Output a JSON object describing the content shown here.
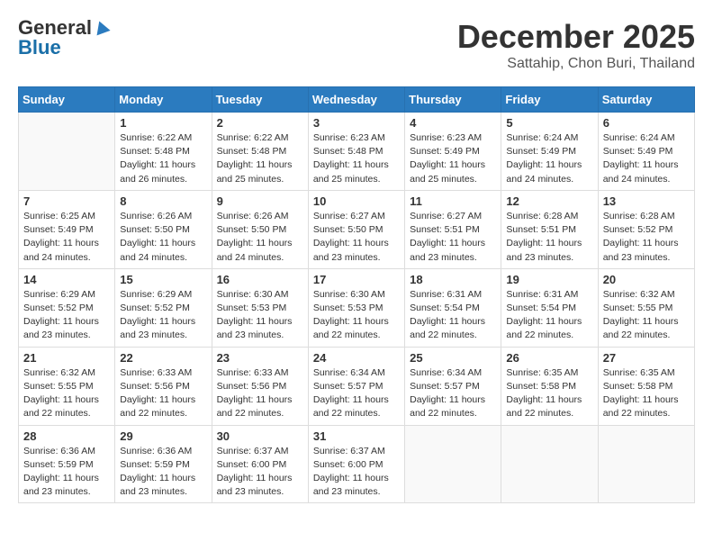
{
  "header": {
    "logo_general": "General",
    "logo_blue": "Blue",
    "month_title": "December 2025",
    "location": "Sattahip, Chon Buri, Thailand"
  },
  "days_of_week": [
    "Sunday",
    "Monday",
    "Tuesday",
    "Wednesday",
    "Thursday",
    "Friday",
    "Saturday"
  ],
  "weeks": [
    [
      {
        "day": "",
        "info": ""
      },
      {
        "day": "1",
        "info": "Sunrise: 6:22 AM\nSunset: 5:48 PM\nDaylight: 11 hours and 26 minutes."
      },
      {
        "day": "2",
        "info": "Sunrise: 6:22 AM\nSunset: 5:48 PM\nDaylight: 11 hours and 25 minutes."
      },
      {
        "day": "3",
        "info": "Sunrise: 6:23 AM\nSunset: 5:48 PM\nDaylight: 11 hours and 25 minutes."
      },
      {
        "day": "4",
        "info": "Sunrise: 6:23 AM\nSunset: 5:49 PM\nDaylight: 11 hours and 25 minutes."
      },
      {
        "day": "5",
        "info": "Sunrise: 6:24 AM\nSunset: 5:49 PM\nDaylight: 11 hours and 24 minutes."
      },
      {
        "day": "6",
        "info": "Sunrise: 6:24 AM\nSunset: 5:49 PM\nDaylight: 11 hours and 24 minutes."
      }
    ],
    [
      {
        "day": "7",
        "info": "Sunrise: 6:25 AM\nSunset: 5:49 PM\nDaylight: 11 hours and 24 minutes."
      },
      {
        "day": "8",
        "info": "Sunrise: 6:26 AM\nSunset: 5:50 PM\nDaylight: 11 hours and 24 minutes."
      },
      {
        "day": "9",
        "info": "Sunrise: 6:26 AM\nSunset: 5:50 PM\nDaylight: 11 hours and 24 minutes."
      },
      {
        "day": "10",
        "info": "Sunrise: 6:27 AM\nSunset: 5:50 PM\nDaylight: 11 hours and 23 minutes."
      },
      {
        "day": "11",
        "info": "Sunrise: 6:27 AM\nSunset: 5:51 PM\nDaylight: 11 hours and 23 minutes."
      },
      {
        "day": "12",
        "info": "Sunrise: 6:28 AM\nSunset: 5:51 PM\nDaylight: 11 hours and 23 minutes."
      },
      {
        "day": "13",
        "info": "Sunrise: 6:28 AM\nSunset: 5:52 PM\nDaylight: 11 hours and 23 minutes."
      }
    ],
    [
      {
        "day": "14",
        "info": "Sunrise: 6:29 AM\nSunset: 5:52 PM\nDaylight: 11 hours and 23 minutes."
      },
      {
        "day": "15",
        "info": "Sunrise: 6:29 AM\nSunset: 5:52 PM\nDaylight: 11 hours and 23 minutes."
      },
      {
        "day": "16",
        "info": "Sunrise: 6:30 AM\nSunset: 5:53 PM\nDaylight: 11 hours and 23 minutes."
      },
      {
        "day": "17",
        "info": "Sunrise: 6:30 AM\nSunset: 5:53 PM\nDaylight: 11 hours and 22 minutes."
      },
      {
        "day": "18",
        "info": "Sunrise: 6:31 AM\nSunset: 5:54 PM\nDaylight: 11 hours and 22 minutes."
      },
      {
        "day": "19",
        "info": "Sunrise: 6:31 AM\nSunset: 5:54 PM\nDaylight: 11 hours and 22 minutes."
      },
      {
        "day": "20",
        "info": "Sunrise: 6:32 AM\nSunset: 5:55 PM\nDaylight: 11 hours and 22 minutes."
      }
    ],
    [
      {
        "day": "21",
        "info": "Sunrise: 6:32 AM\nSunset: 5:55 PM\nDaylight: 11 hours and 22 minutes."
      },
      {
        "day": "22",
        "info": "Sunrise: 6:33 AM\nSunset: 5:56 PM\nDaylight: 11 hours and 22 minutes."
      },
      {
        "day": "23",
        "info": "Sunrise: 6:33 AM\nSunset: 5:56 PM\nDaylight: 11 hours and 22 minutes."
      },
      {
        "day": "24",
        "info": "Sunrise: 6:34 AM\nSunset: 5:57 PM\nDaylight: 11 hours and 22 minutes."
      },
      {
        "day": "25",
        "info": "Sunrise: 6:34 AM\nSunset: 5:57 PM\nDaylight: 11 hours and 22 minutes."
      },
      {
        "day": "26",
        "info": "Sunrise: 6:35 AM\nSunset: 5:58 PM\nDaylight: 11 hours and 22 minutes."
      },
      {
        "day": "27",
        "info": "Sunrise: 6:35 AM\nSunset: 5:58 PM\nDaylight: 11 hours and 22 minutes."
      }
    ],
    [
      {
        "day": "28",
        "info": "Sunrise: 6:36 AM\nSunset: 5:59 PM\nDaylight: 11 hours and 23 minutes."
      },
      {
        "day": "29",
        "info": "Sunrise: 6:36 AM\nSunset: 5:59 PM\nDaylight: 11 hours and 23 minutes."
      },
      {
        "day": "30",
        "info": "Sunrise: 6:37 AM\nSunset: 6:00 PM\nDaylight: 11 hours and 23 minutes."
      },
      {
        "day": "31",
        "info": "Sunrise: 6:37 AM\nSunset: 6:00 PM\nDaylight: 11 hours and 23 minutes."
      },
      {
        "day": "",
        "info": ""
      },
      {
        "day": "",
        "info": ""
      },
      {
        "day": "",
        "info": ""
      }
    ]
  ]
}
